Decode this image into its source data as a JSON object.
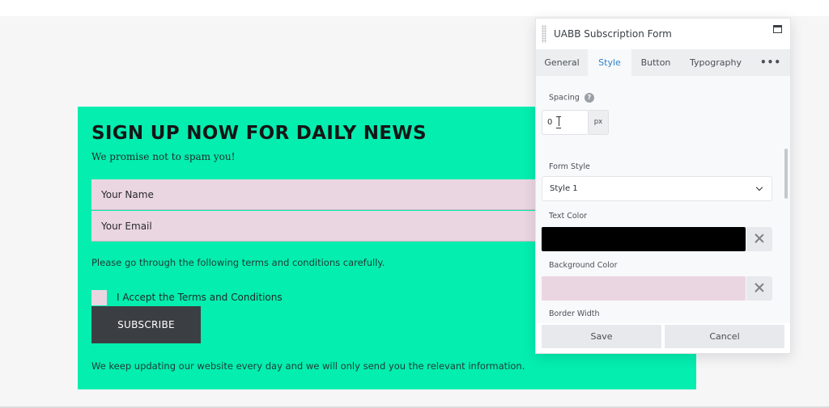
{
  "subscribe_form": {
    "heading": "SIGN UP NOW FOR DAILY NEWS",
    "tagline": "We promise not to spam you!",
    "name_placeholder": "Your Name",
    "email_placeholder": "Your Email",
    "terms_text": "Please go through the following terms and conditions carefully.",
    "accept_label": "I Accept the Terms and Conditions",
    "button_label": "SUBSCRIBE",
    "footer_note": "We keep updating our website every day and we will only send you the relevant information.",
    "background_color": "#04eeb0",
    "field_color": "#ead6e1",
    "button_color": "#3b3f43"
  },
  "settings_panel": {
    "title": "UABB Subscription Form",
    "tabs": [
      {
        "label": "General",
        "active": false
      },
      {
        "label": "Style",
        "active": true
      },
      {
        "label": "Button",
        "active": false
      },
      {
        "label": "Typography",
        "active": false
      }
    ],
    "more_label": "•••",
    "fields": {
      "spacing": {
        "label": "Spacing",
        "help": "?",
        "value": "0",
        "unit": "px"
      },
      "form_style": {
        "label": "Form Style",
        "value": "Style 1"
      },
      "text_color": {
        "label": "Text Color",
        "value": "#000000"
      },
      "background_color": {
        "label": "Background Color",
        "value": "#ead6e1"
      },
      "border_width": {
        "label": "Border Width"
      }
    },
    "save_label": "Save",
    "cancel_label": "Cancel"
  }
}
